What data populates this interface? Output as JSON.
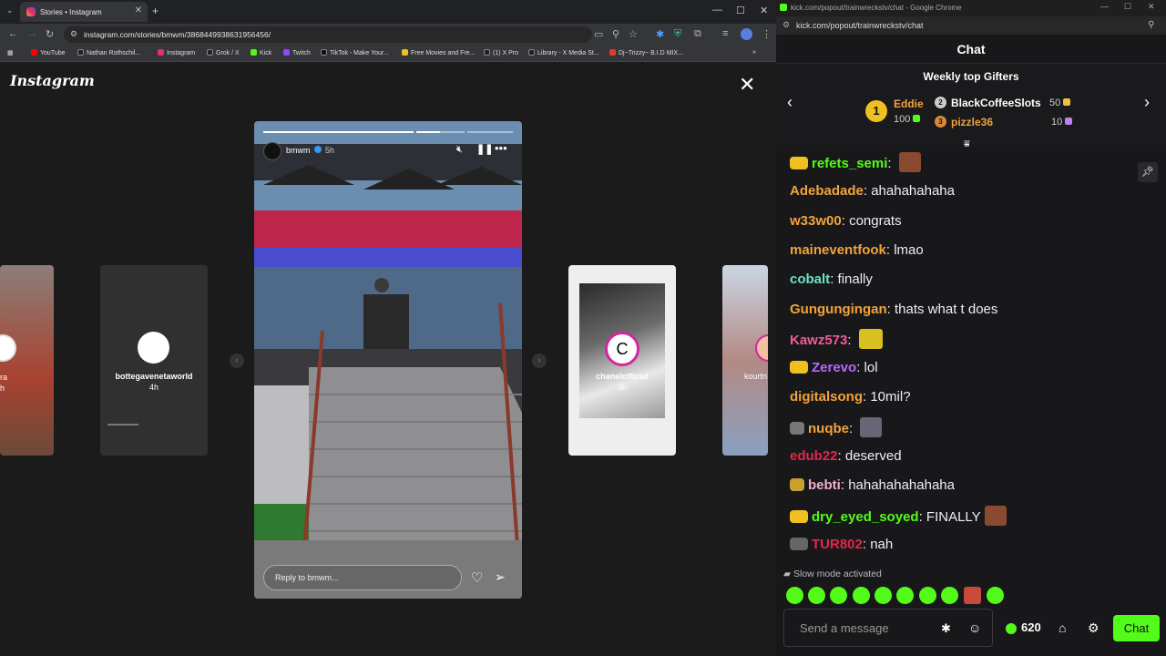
{
  "left_window": {
    "tab_title": "Stories • Instagram",
    "url": "instagram.com/stories/bmwm/3868449938631956456/",
    "bookmarks": [
      "YouTube",
      "Nathan Rothschil...",
      "Instagram",
      "Grok / X",
      "Kick",
      "Twitch",
      "TikTok - Make Your...",
      "Free Movies and Fre...",
      "(1) X Pro",
      "Library - X Media St...",
      "Dj~Trizzy~ B.I.D MIX..."
    ],
    "logo": "Instagram",
    "left_partial_user": "ra",
    "left_partial_time": "h",
    "side_story_1_user": "bottegavenetaworld",
    "side_story_1_time": "4h",
    "side_story_2_user": "chanelofficial",
    "side_story_2_time": "3h",
    "side_story_3_user": "kourtn",
    "story": {
      "username": "bmwm",
      "time": "5h",
      "reply_placeholder": "Reply to bmwm...",
      "progress_segments": 5,
      "active_segment": 3
    }
  },
  "right_window": {
    "title": "kick.com/popout/trainwreckstv/chat - Google Chrome",
    "url": "kick.com/popout/trainwreckstv/chat",
    "chat_header": "Chat",
    "gifters_title": "Weekly top Gifters",
    "gifters": [
      {
        "rank": "1",
        "name": "Eddie",
        "amount": "100"
      },
      {
        "rank": "2",
        "name": "BlackCoffeeSlots",
        "amount": "50"
      },
      {
        "rank": "3",
        "name": "pizzle36",
        "amount": "10"
      }
    ],
    "messages": [
      {
        "user": "refets_semi",
        "color": "#53fc18",
        "text": "",
        "badge": "#f0c020",
        "emote": "#8a4a30"
      },
      {
        "user": "Adebadade",
        "color": "#f2a33a",
        "text": "ahahahahaha"
      },
      {
        "user": "w33w00",
        "color": "#f2a33a",
        "text": "congrats"
      },
      {
        "user": "maineventfook",
        "color": "#f2a33a",
        "text": "lmao"
      },
      {
        "user": "cobalt",
        "color": "#6ee0c8",
        "text": "finally"
      },
      {
        "user": "Gungungingan",
        "color": "#f2a33a",
        "text": "thats what t does"
      },
      {
        "user": "Kawz573",
        "color": "#f25a9b",
        "text": "",
        "emote": "#d8c020"
      },
      {
        "user": "Zerevo",
        "color": "#b768ff",
        "text": "lol",
        "badge": "#f0c020"
      },
      {
        "user": "digitalsong",
        "color": "#f2a33a",
        "text": "10mil?"
      },
      {
        "user": "nuqbe",
        "color": "#f2a33a",
        "text": "",
        "badge": "#777",
        "emote": "#667"
      },
      {
        "user": "edub22",
        "color": "#e0284a",
        "text": "deserved"
      },
      {
        "user": "bebti",
        "color": "#f0b0c8",
        "text": "hahahahahahaha",
        "badge": "#c8a030"
      },
      {
        "user": "dry_eyed_soyed",
        "color": "#53fc18",
        "text": "FINALLY",
        "badge": "#f0c020",
        "emote": "#8a4a30"
      },
      {
        "user": "TUR802",
        "color": "#e0284a",
        "text": "nah",
        "badge": "#666"
      }
    ],
    "slow_mode": "Slow mode activated",
    "input_placeholder": "Send a message",
    "points": "620",
    "chat_button": "Chat",
    "accent": "#53fc18"
  }
}
